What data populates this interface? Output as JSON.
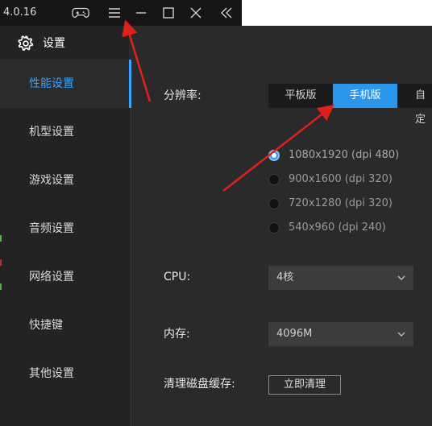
{
  "titlebar": {
    "version": "4.0.16",
    "icons": [
      "gamepad-icon",
      "menu-icon",
      "minimize-icon",
      "maximize-icon",
      "close-icon",
      "collapse-icon"
    ]
  },
  "window": {
    "title": "设置",
    "icon": "gear-icon"
  },
  "sidebar": {
    "items": [
      {
        "label": "性能设置",
        "active": true
      },
      {
        "label": "机型设置",
        "active": false
      },
      {
        "label": "游戏设置",
        "active": false
      },
      {
        "label": "音频设置",
        "active": false
      },
      {
        "label": "网络设置",
        "active": false
      },
      {
        "label": "快捷键",
        "active": false
      },
      {
        "label": "其他设置",
        "active": false
      }
    ]
  },
  "performance": {
    "resolution_label": "分辨率:",
    "resolution_tabs": [
      {
        "label": "平板版",
        "active": false
      },
      {
        "label": "手机版",
        "active": true
      },
      {
        "label": "自定",
        "active": false
      }
    ],
    "resolution_options": [
      {
        "label": "1080x1920 (dpi 480)",
        "selected": true
      },
      {
        "label": "900x1600 (dpi 320)",
        "selected": false
      },
      {
        "label": "720x1280 (dpi 320)",
        "selected": false
      },
      {
        "label": "540x960 (dpi 240)",
        "selected": false
      }
    ],
    "cpu_label": "CPU:",
    "cpu_value": "4核",
    "memory_label": "内存:",
    "memory_value": "4096M",
    "disk_cache_label": "清理磁盘缓存:",
    "clear_button": "立即清理"
  },
  "colors": {
    "accent": "#2a97ec",
    "annotation_arrow": "#e0201b"
  }
}
